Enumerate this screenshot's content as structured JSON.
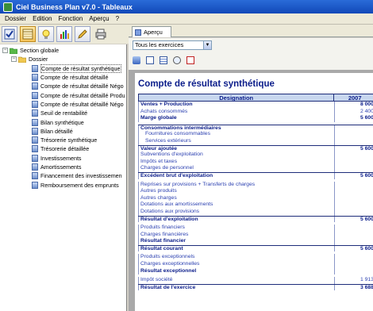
{
  "window": {
    "title": "Ciel Business Plan v7.0 - Tableaux"
  },
  "menu": [
    "Dossier",
    "Edition",
    "Fonction",
    "Aperçu",
    "?"
  ],
  "toolbar": {
    "icons": [
      "check-icon",
      "calendar-icon",
      "lightbulb-icon",
      "chart-icon",
      "pencil-icon",
      "printer-icon"
    ]
  },
  "tree": {
    "root": "Section globale",
    "folder": "Dossier",
    "items": [
      "Compte de résultat synthétique",
      "Compte de résultat détaillé",
      "Compte de résultat détaillé Négo",
      "Compte de résultat détaillé Produ",
      "Compte de résultat détaillé Négo",
      "Seuil de rentabilité",
      "Bilan synthétique",
      "Bilan détaillé",
      "Trésorerie synthétique",
      "Trésorerie détaillée",
      "Investissements",
      "Amortissements",
      "Financement des investissemen",
      "Remboursement des emprunts"
    ],
    "selected_index": 0
  },
  "tab": {
    "label": "Aperçu"
  },
  "exercise_select": {
    "value": "Tous les exercices"
  },
  "report": {
    "title": "Compte de résultat synthétique",
    "col_designation": "Designation",
    "col_year": "2007",
    "rows": [
      {
        "label": "Ventes + Production",
        "value": "8 000",
        "style": "bold"
      },
      {
        "label": "Achats consommés",
        "value": "2 400",
        "style": "normal"
      },
      {
        "label": "Marge globale",
        "value": "5 600",
        "style": "bold"
      },
      {
        "label": "",
        "value": "",
        "style": "gap"
      },
      {
        "label": "Consommations intermédiaires",
        "value": "",
        "style": "bold-sep"
      },
      {
        "label": "Fournitures consommables",
        "value": "",
        "style": "indent"
      },
      {
        "label": "Services extérieurs",
        "value": "",
        "style": "indent"
      },
      {
        "label": "Valeur ajoutée",
        "value": "5 600",
        "style": "bold-sep"
      },
      {
        "label": "Subventions d'exploitation",
        "value": "",
        "style": "normal"
      },
      {
        "label": "Impôts et taxes",
        "value": "",
        "style": "normal"
      },
      {
        "label": "Charges de personnel",
        "value": "",
        "style": "normal"
      },
      {
        "label": "Excédent brut d'exploitation",
        "value": "5 600",
        "style": "bold-sep"
      },
      {
        "label": "",
        "value": "",
        "style": "gap"
      },
      {
        "label": "Reprises sur provisions + Transferts de charges",
        "value": "",
        "style": "normal"
      },
      {
        "label": "Autres produits",
        "value": "",
        "style": "normal"
      },
      {
        "label": "Autres charges",
        "value": "",
        "style": "normal"
      },
      {
        "label": "Dotations aux amortissements",
        "value": "",
        "style": "normal"
      },
      {
        "label": "Dotations aux provisions",
        "value": "",
        "style": "normal"
      },
      {
        "label": "Résultat d'exploitation",
        "value": "5 600",
        "style": "bold-sep"
      },
      {
        "label": "",
        "value": "",
        "style": "gap"
      },
      {
        "label": "Produits financiers",
        "value": "",
        "style": "normal"
      },
      {
        "label": "Charges financières",
        "value": "",
        "style": "normal"
      },
      {
        "label": "Résultat financier",
        "value": "",
        "style": "bold"
      },
      {
        "label": "Résultat courant",
        "value": "5 600",
        "style": "bold-sep"
      },
      {
        "label": "",
        "value": "",
        "style": "gap"
      },
      {
        "label": "Produits exceptionnels",
        "value": "",
        "style": "normal"
      },
      {
        "label": "Charges exceptionnelles",
        "value": "",
        "style": "normal"
      },
      {
        "label": "Résultat exceptionnel",
        "value": "",
        "style": "bold"
      },
      {
        "label": "",
        "value": "",
        "style": "gap"
      },
      {
        "label": "Impôt société",
        "value": "1 913",
        "style": "normal"
      },
      {
        "label": "Résultat de l'exercice",
        "value": "3 688",
        "style": "bold-sep"
      }
    ]
  }
}
